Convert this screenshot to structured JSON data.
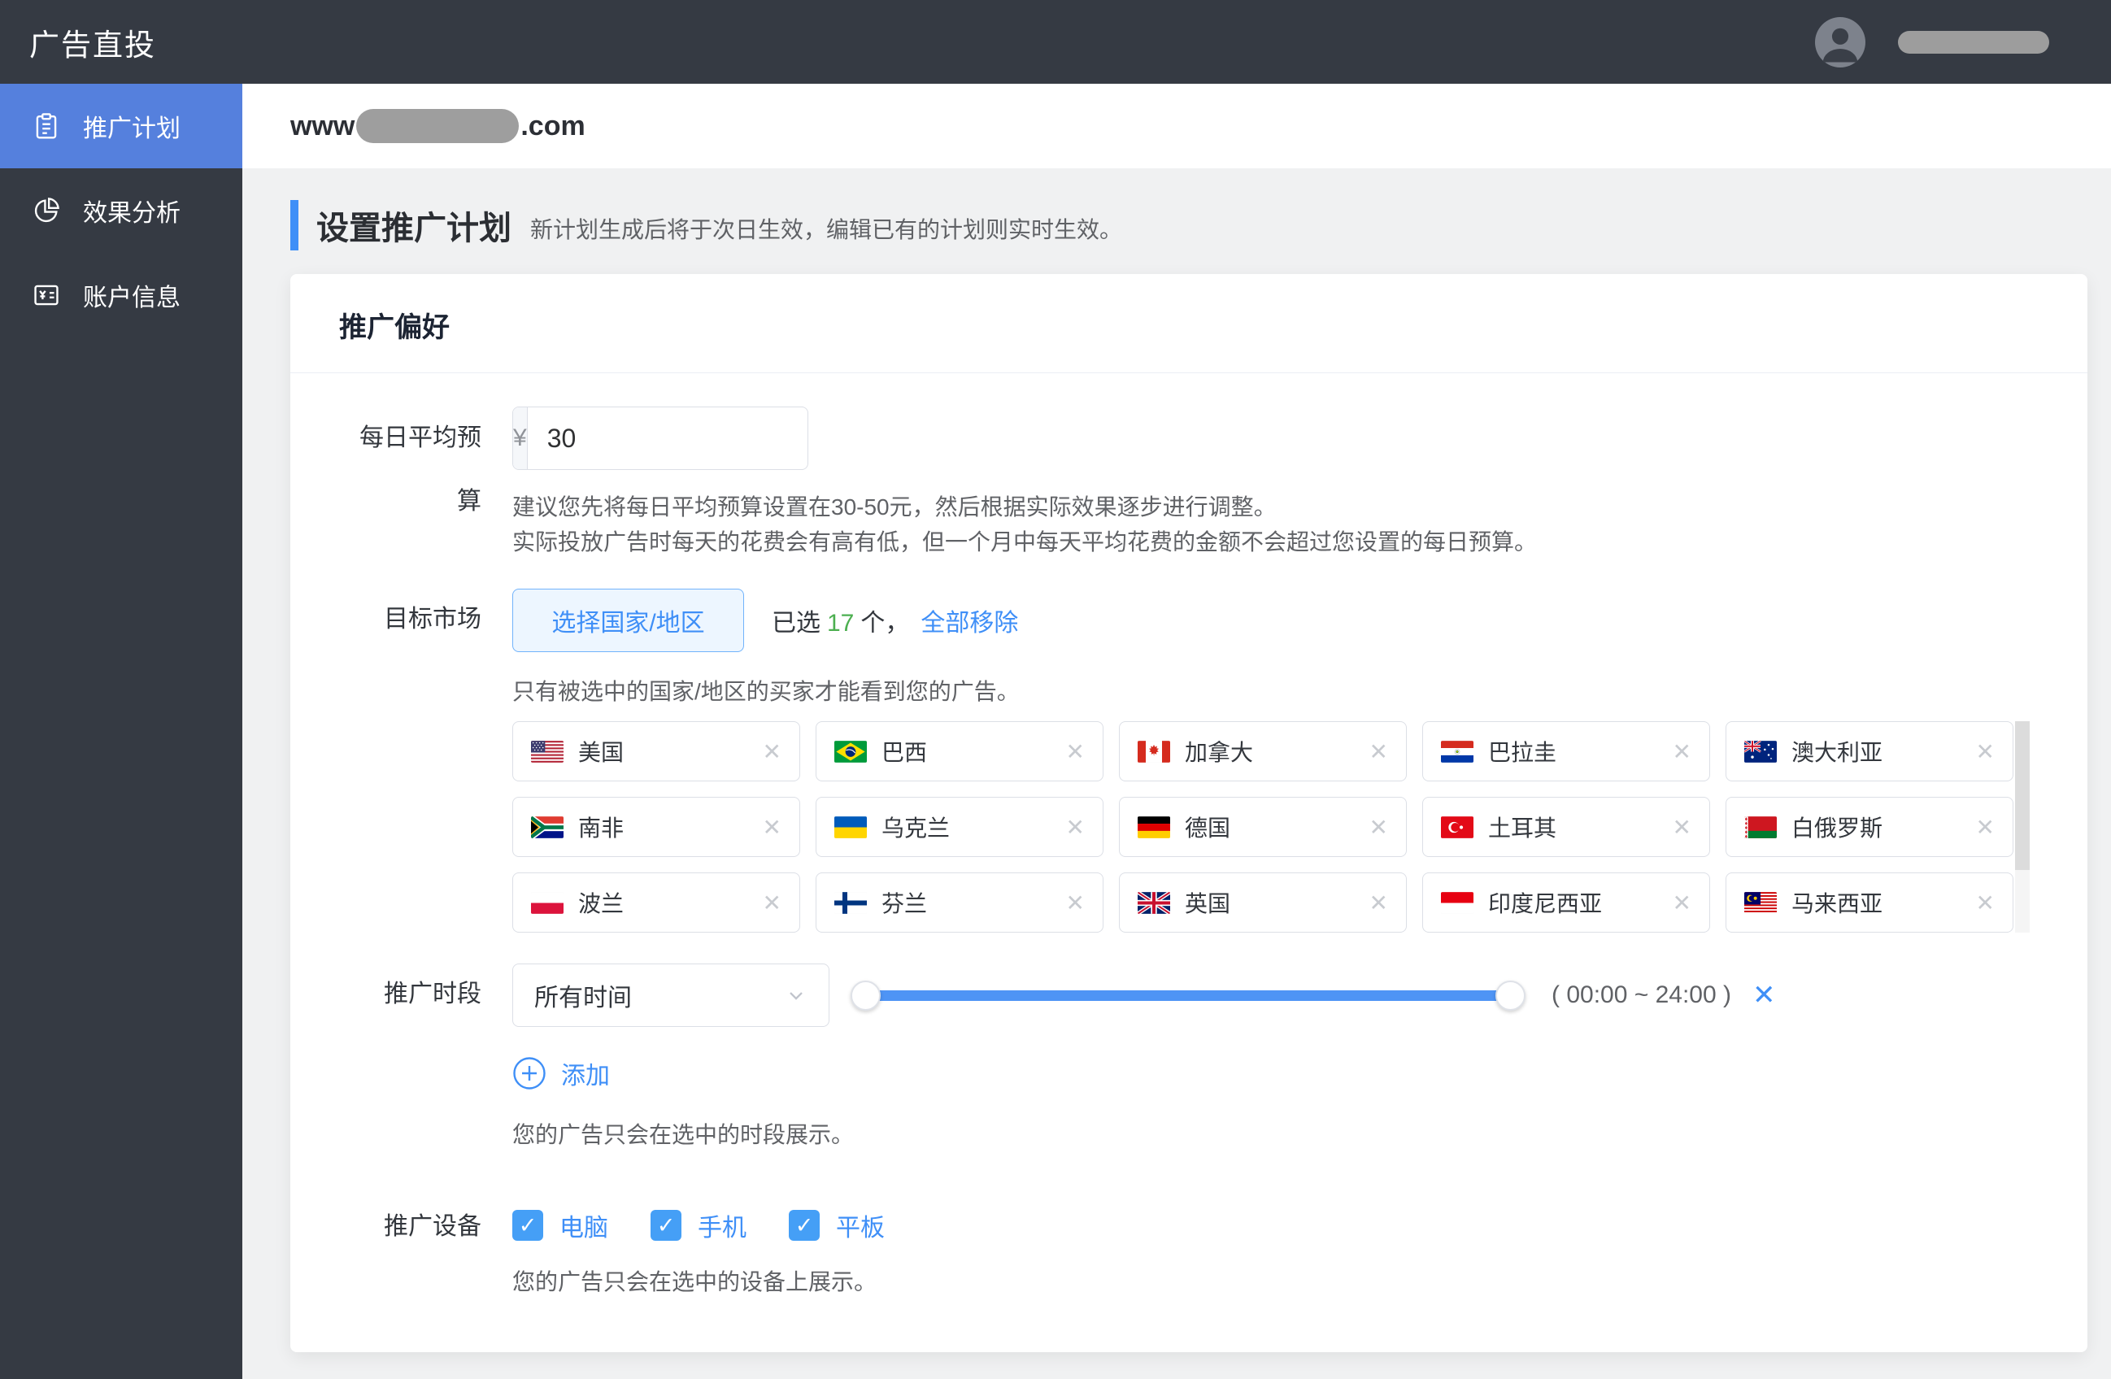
{
  "topbar": {
    "title": "广告直投"
  },
  "sidebar": {
    "items": [
      {
        "label": "推广计划",
        "icon": "clipboard",
        "active": true
      },
      {
        "label": "效果分析",
        "icon": "pie-chart",
        "active": false
      },
      {
        "label": "账户信息",
        "icon": "account-card",
        "active": false
      }
    ]
  },
  "site_header": {
    "prefix": "www",
    "suffix": ".com",
    "middle_redacted": true
  },
  "page_header": {
    "title": "设置推广计划",
    "subtitle": "新计划生成后将于次日生效，编辑已有的计划则实时生效。"
  },
  "card": {
    "title": "推广偏好"
  },
  "budget": {
    "label": "每日平均预算",
    "currency_symbol": "¥",
    "value": "30",
    "hint_line1": "建议您先将每日平均预算设置在30-50元，然后根据实际效果逐步进行调整。",
    "hint_line2": "实际投放广告时每天的花费会有高有低，但一个月中每天平均花费的金额不会超过您设置的每日预算。"
  },
  "target_market": {
    "label": "目标市场",
    "select_button_label": "选择国家/地区",
    "selected_text_prefix": "已选",
    "selected_count": "17",
    "selected_text_suffix": "个，",
    "remove_all_label": "全部移除",
    "hint": "只有被选中的国家/地区的买家才能看到您的广告。",
    "countries": [
      {
        "name": "美国",
        "code": "us"
      },
      {
        "name": "巴西",
        "code": "br"
      },
      {
        "name": "加拿大",
        "code": "ca"
      },
      {
        "name": "巴拉圭",
        "code": "py"
      },
      {
        "name": "澳大利亚",
        "code": "au"
      },
      {
        "name": "南非",
        "code": "za"
      },
      {
        "name": "乌克兰",
        "code": "ua"
      },
      {
        "name": "德国",
        "code": "de"
      },
      {
        "name": "土耳其",
        "code": "tr"
      },
      {
        "name": "白俄罗斯",
        "code": "by"
      },
      {
        "name": "波兰",
        "code": "pl"
      },
      {
        "name": "芬兰",
        "code": "fi"
      },
      {
        "name": "英国",
        "code": "gb"
      },
      {
        "name": "印度尼西亚",
        "code": "id"
      },
      {
        "name": "马来西亚",
        "code": "my"
      }
    ]
  },
  "schedule": {
    "label": "推广时段",
    "dropdown_value": "所有时间",
    "time_range": "( 00:00 ~ 24:00 )",
    "add_label": "添加",
    "hint": "您的广告只会在选中的时段展示。"
  },
  "devices": {
    "label": "推广设备",
    "options": [
      {
        "label": "电脑",
        "checked": true
      },
      {
        "label": "手机",
        "checked": true
      },
      {
        "label": "平板",
        "checked": true
      }
    ],
    "hint": "您的广告只会在选中的设备上展示。"
  },
  "colors": {
    "dark_bg": "#353a43",
    "sidebar_active_blue": "#5580dd",
    "accent_blue": "#3f8ff7",
    "slider_blue": "#4e94f5",
    "success_green": "#4caf50"
  }
}
